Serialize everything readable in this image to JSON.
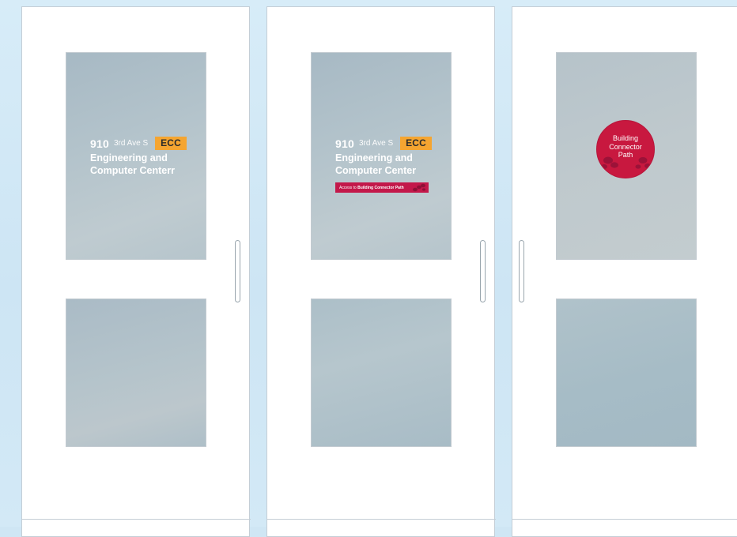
{
  "doors": [
    {
      "sign": {
        "number": "910",
        "street": "3rd Ave S",
        "badge": "ECC",
        "name_line1": "Engineering and",
        "name_line2": "Computer Centerr"
      }
    },
    {
      "sign": {
        "number": "910",
        "street": "3rd Ave S",
        "badge": "ECC",
        "name_line1": "Engineering and",
        "name_line2": "Computer Center",
        "access_prefix": "Access to",
        "access_label": "Building Connector Path"
      }
    },
    {
      "circle_sign": {
        "line1": "Building",
        "line2": "Connector",
        "line3": "Path"
      }
    }
  ],
  "colors": {
    "badge": "#f5a531",
    "connector_red": "#c8183f",
    "background": "#cfe6f4"
  }
}
